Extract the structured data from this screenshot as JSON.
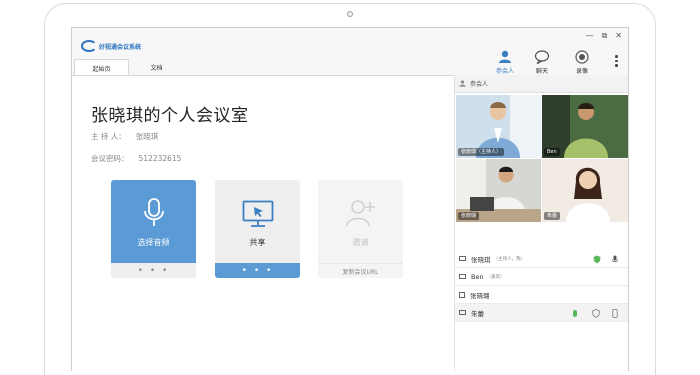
{
  "app": {
    "logo_text": "好视通会议系统"
  },
  "window_controls": [
    "—",
    "⧉",
    "✕"
  ],
  "toolbar": {
    "participants_label": "参会人",
    "chat_label": "聊天",
    "record_label": "录像"
  },
  "tabs": [
    {
      "label": "起始页",
      "active": true
    },
    {
      "label": "文档",
      "active": false
    }
  ],
  "room": {
    "title": "张晓琪的个人会议室",
    "host_label": "主 持 人：",
    "host_value": "张晓琪",
    "password_label": "会议密码：",
    "password_value": "512232615"
  },
  "cards": [
    {
      "label": "选择音频",
      "footer": "• • •",
      "icon": "microphone-icon",
      "state": "primary"
    },
    {
      "label": "共享",
      "footer": "• • •",
      "icon": "screen-share-icon",
      "state": "normal"
    },
    {
      "label": "邀请",
      "footer": "复制会议URL",
      "icon": "add-user-icon",
      "state": "disabled"
    }
  ],
  "right_panel": {
    "header": "参会人",
    "videos": [
      {
        "name": "张晓琪（主持人）"
      },
      {
        "name": "Ben"
      },
      {
        "name": "张晓璐"
      },
      {
        "name": "朱蕾"
      }
    ],
    "participants": [
      {
        "name": "张晓琪",
        "role": "（主持人，我）"
      },
      {
        "name": "Ben",
        "role": "（嘉宾）"
      },
      {
        "name": "张晓璐",
        "role": ""
      },
      {
        "name": "朱蕾",
        "role": ""
      }
    ]
  },
  "colors": {
    "primary_card": "#5b9bd5",
    "accent_blue": "#3a7ec2",
    "status_green": "#5cb85c"
  }
}
